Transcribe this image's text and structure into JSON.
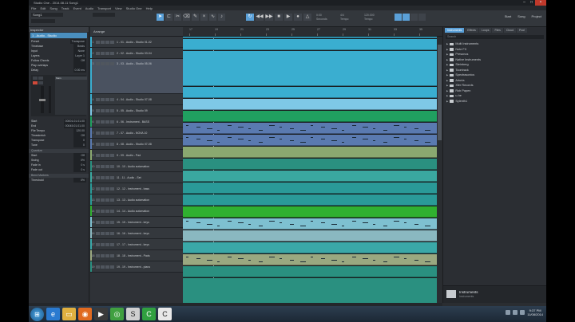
{
  "window": {
    "title": "Studio One - 2014.08.11 Song1",
    "menu": [
      "File",
      "Edit",
      "Song",
      "Track",
      "Event",
      "Audio",
      "Transport",
      "View",
      "Studio One",
      "Help"
    ]
  },
  "toolbar": {
    "song_field": "Song1",
    "tools": [
      "arrow-icon",
      "range-icon",
      "split-icon",
      "eraser-icon",
      "paint-icon",
      "mute-icon",
      "bend-icon",
      "listen-icon"
    ],
    "transport": [
      "loop-icon",
      "rewind-icon",
      "forward-icon",
      "stop-icon",
      "play-icon",
      "record-icon",
      "metronome-icon"
    ],
    "info_left": [
      "0:00",
      "Seconds"
    ],
    "info_mid": [
      "4/4",
      "Tempo"
    ],
    "info_right": [
      "120.000",
      "Tempo"
    ],
    "right_buttons": [
      "Start",
      "Song",
      "Project"
    ]
  },
  "inspector": {
    "header": "Inspector",
    "track_name": "1 - Audio - Studio",
    "rows": [
      {
        "label": "Preset",
        "value": "Transpose"
      },
      {
        "label": "Timebase",
        "value": "Beats"
      },
      {
        "label": "Input",
        "value": "None"
      },
      {
        "label": "Layers",
        "value": "Layer 1"
      },
      {
        "label": "Follow Chords",
        "value": "Off"
      },
      {
        "label": "Play overlaps",
        "value": ""
      },
      {
        "label": "Delay",
        "value": "0.00 ms"
      }
    ],
    "section_mix": "Main",
    "rows2": [
      {
        "label": "Start",
        "value": "00001.01.01.00"
      },
      {
        "label": "End",
        "value": "00045.01.01.00"
      },
      {
        "label": "File Tempo",
        "value": "120.00"
      },
      {
        "label": "Timestretch",
        "value": "Off"
      },
      {
        "label": "Transpose",
        "value": "0"
      },
      {
        "label": "Tune",
        "value": "0"
      }
    ],
    "section_quant": "Quantize",
    "rows3": [
      {
        "label": "Start",
        "value": "Off"
      },
      {
        "label": "Swing",
        "value": "0%"
      },
      {
        "label": "Fade in",
        "value": "0 s"
      },
      {
        "label": "Fade out",
        "value": "0 s"
      }
    ],
    "section_bend": "Bend Markers",
    "rows4": [
      {
        "label": "Threshold",
        "value": "0%"
      }
    ]
  },
  "tracklist": {
    "header": "Arrange",
    "tracks": [
      {
        "num": "1",
        "name": "1 - 01 - Audio - Studio 01-02",
        "color": "#3aaed0"
      },
      {
        "num": "2",
        "name": "2 - 02 - Audio - Studio 03-04",
        "color": "#3aaed0"
      },
      {
        "num": "3",
        "name": "3 - 03 - Audio - Studio 05-06",
        "color": "#3aaed0"
      },
      {
        "num": "4",
        "name": "4 - 04 - Audio - Studio 07-08",
        "color": "#3aaed0"
      },
      {
        "num": "5",
        "name": "5 - 05 - Audio - Studio 09",
        "color": "#7ec8e6"
      },
      {
        "num": "6",
        "name": "6 - 06 - Instrument - BASS",
        "color": "#20a060"
      },
      {
        "num": "7",
        "name": "7 - 07 - Audio - NOVA 10",
        "color": "#5a7ab0"
      },
      {
        "num": "8",
        "name": "8 - 08 - Audio - Studio 07-08",
        "color": "#5a7ab0"
      },
      {
        "num": "9",
        "name": "9 - 09 - Audio - Pad",
        "color": "#8aa870"
      },
      {
        "num": "10",
        "name": "10 - 10 - Audio automation",
        "color": "#2a9080"
      },
      {
        "num": "11",
        "name": "11 - 11 - Audio - Set",
        "color": "#3aa8a0"
      },
      {
        "num": "12",
        "name": "12 - 12 - Instrument - bass",
        "color": "#2a9a98"
      },
      {
        "num": "13",
        "name": "13 - 13 - Audio automation",
        "color": "#2a9a98"
      },
      {
        "num": "14",
        "name": "14 - 14 - Audio automation",
        "color": "#30b030"
      },
      {
        "num": "15",
        "name": "15 - 15 - Instrument - keys",
        "color": "#7ec0d0"
      },
      {
        "num": "16",
        "name": "16 - 16 - Instrument - keys",
        "color": "#8ab8c0"
      },
      {
        "num": "17",
        "name": "17 - 17 - Instrument - keys",
        "color": "#3aa8a8"
      },
      {
        "num": "18",
        "name": "18 - 18 - Instrument - Pads",
        "color": "#9aa880"
      },
      {
        "num": "19",
        "name": "19 - 19 - Instrument - piano",
        "color": "#2a9080"
      }
    ]
  },
  "ruler": {
    "ticks": [
      "17",
      "19",
      "21",
      "23",
      "25",
      "27",
      "29",
      "31",
      "33",
      "35"
    ]
  },
  "browser": {
    "tabs": [
      "Instruments",
      "Effects",
      "Loops",
      "Files",
      "Cloud",
      "Pool"
    ],
    "active_tab": "Instruments",
    "search_placeholder": "Search",
    "items": [
      "Multi Instruments",
      "Note FX",
      "Presonus",
      "Native Instruments",
      "Steinberg",
      "Toontrack",
      "Spectrasonics",
      "Arturia",
      "Xfer Records",
      "Rob Papen",
      "u-he",
      "Sylenth1"
    ],
    "footer_title": "Instruments",
    "footer_sub": "Instruments"
  },
  "taskbar": {
    "apps": [
      "ie-icon",
      "explorer-icon",
      "firefox-icon",
      "media-icon",
      "chrome-icon",
      "studio-one-icon",
      "camtasia-icon",
      "camtasia2-icon"
    ],
    "clock_time": "9:37 PM",
    "clock_date": "11/08/2014"
  }
}
